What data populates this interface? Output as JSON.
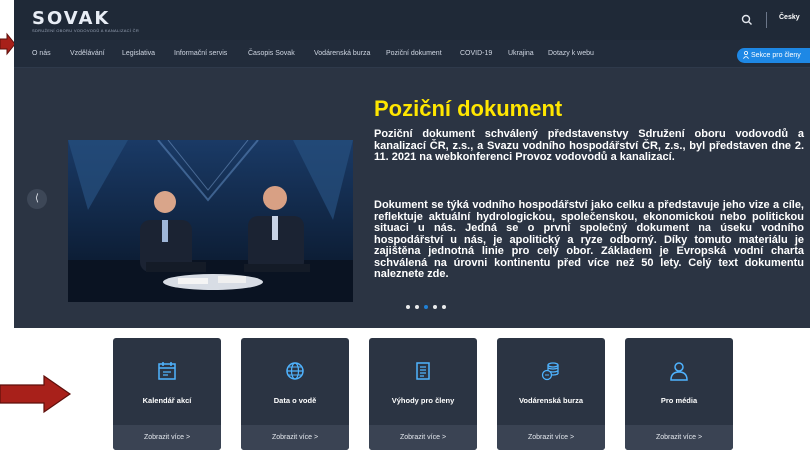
{
  "header": {
    "logo_text": "SOVAK",
    "logo_sub": "SDRUŽENÍ OBORU VODOVODŮ A KANALIZACÍ ČR",
    "language": "Česky"
  },
  "nav": {
    "items": [
      "O nás",
      "Vzdělávání",
      "Legislativa",
      "Informační servis",
      "Časopis Sovak",
      "Vodárenská burza",
      "Poziční dokument",
      "COVID-19",
      "Ukrajina",
      "Dotazy k webu"
    ],
    "section_button": "Sekce pro členy"
  },
  "slide": {
    "title": "Poziční dokument",
    "paragraph1": "Poziční dokument schválený představenstvy Sdružení oboru vodovodů a kanalizací ČR, z.s., a Svazu vodního hospodářství ČR, z.s., byl představen dne 2. 11. 2021 na webkonferenci Provoz vodovodů a kanalizací.",
    "paragraph2": "Dokument se týká vodního hospodářství jako celku a představuje jeho vize a cíle, reflektuje aktuální hydrologickou, společenskou, ekonomickou nebo politickou situaci u nás. Jedná se o první společný dokument na úseku vodního hospodářství u nás, je apolitický a ryze odborný. Díky tomuto materiálu je zajištěna jednotná linie pro celý obor. Základem je Evropská vodní charta schválená na úrovni kontinentu před více než 50 lety. Celý text dokumentu naleznete zde.",
    "prev_symbol": "⟨"
  },
  "cards": [
    {
      "title": "Kalendář akcí",
      "more": "Zobrazit více  >",
      "icon": "calendar-icon"
    },
    {
      "title": "Data o vodě",
      "more": "Zobrazit více  >",
      "icon": "globe-icon"
    },
    {
      "title": "Výhody pro členy",
      "more": "Zobrazit více  >",
      "icon": "document-icon"
    },
    {
      "title": "Vodárenská burza",
      "more": "Zobrazit více  >",
      "icon": "coins-icon"
    },
    {
      "title": "Pro média",
      "more": "Zobrazit více  >",
      "icon": "user-icon"
    }
  ],
  "colors": {
    "frame_bg": "#2b3443",
    "header_bg": "#1f2937",
    "accent_blue": "#1e88e5",
    "title_yellow": "#ffe600",
    "annotation_arrow": "#a8201a"
  }
}
